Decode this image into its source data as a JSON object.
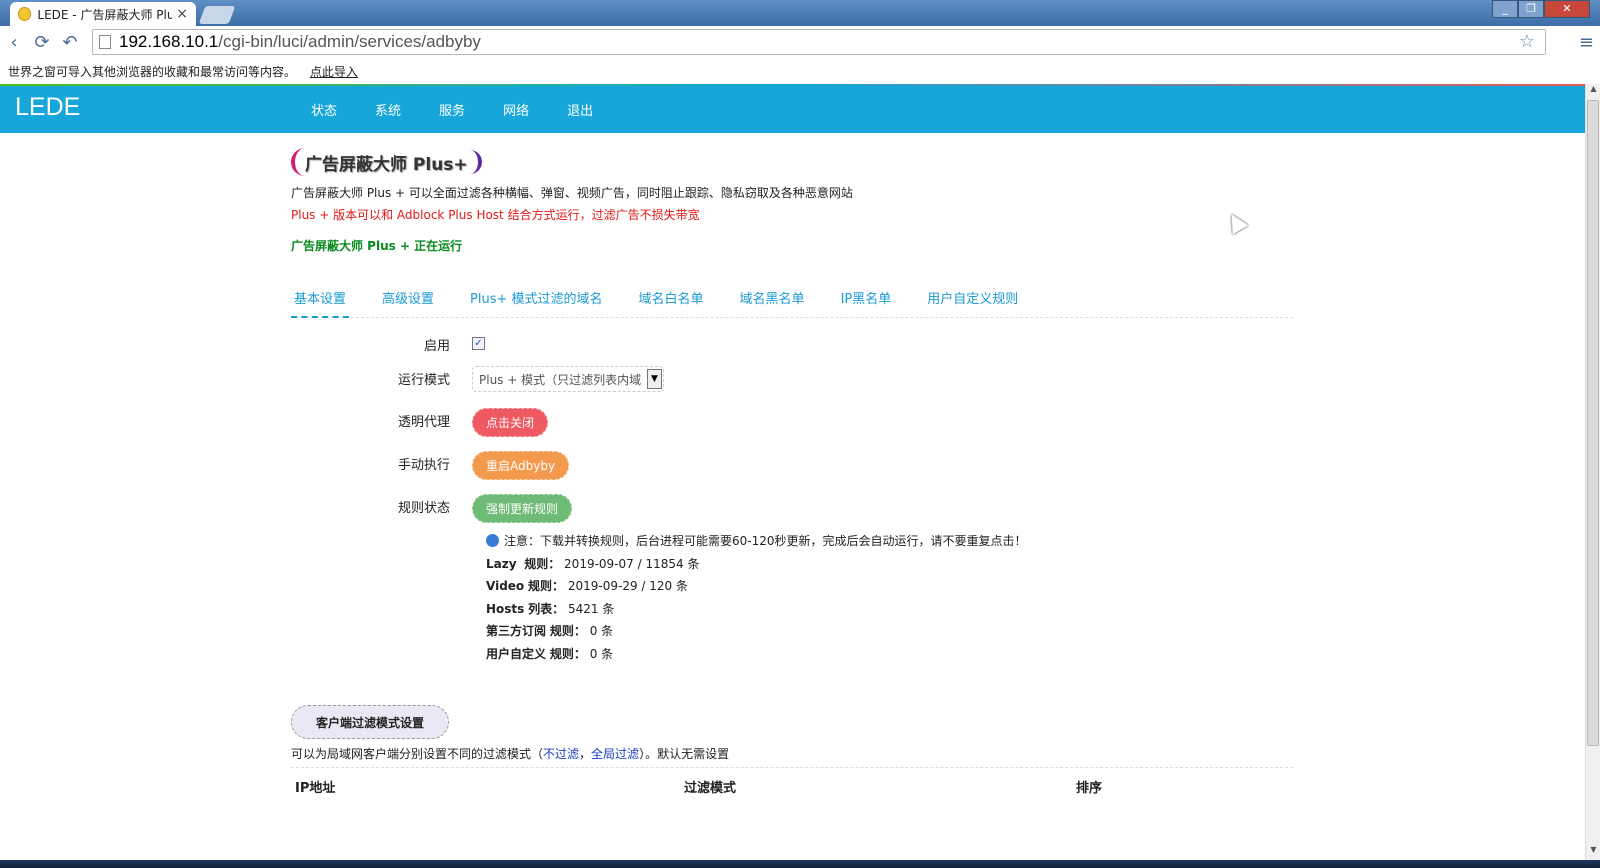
{
  "browser": {
    "tab_title": "LEDE - 广告屏蔽大师 Plus",
    "tab_close": "×",
    "url_host": "192.168.10.1",
    "url_path": "/cgi-bin/luci/admin/services/adbyby",
    "bookmark_message": "世界之窗可导入其他浏览器的收藏和最常访问等内容。",
    "bookmark_link": "点此导入"
  },
  "header": {
    "brand": "LEDE",
    "menu": [
      "状态",
      "系统",
      "服务",
      "网络",
      "退出"
    ]
  },
  "page": {
    "logo_text": "广告屏蔽大师 Plus+",
    "description": "广告屏蔽大师 Plus + 可以全面过滤各种横幅、弹窗、视频广告，同时阻止跟踪、隐私窃取及各种恶意网站",
    "description_red": "Plus + 版本可以和 Adblock Plus Host 结合方式运行，过滤广告不损失带宽",
    "status": "广告屏蔽大师 Plus + 正在运行",
    "tabs": [
      "基本设置",
      "高级设置",
      "Plus+ 模式过滤的域名",
      "域名白名单",
      "域名黑名单",
      "IP黑名单",
      "用户自定义规则"
    ],
    "active_tab": 0
  },
  "form": {
    "enable_label": "启用",
    "enable_checked": true,
    "mode_label": "运行模式",
    "mode_value": "Plus + 模式（只过滤列表内域",
    "proxy_label": "透明代理",
    "proxy_button": "点击关闭",
    "manual_label": "手动执行",
    "manual_button": "重启Adbyby",
    "rules_label": "规则状态",
    "rules_button": "强制更新规则",
    "notice": "注意：下载并转换规则，后台进程可能需要60-120秒更新，完成后会自动运行，请不要重复点击！",
    "rules": [
      {
        "name": "Lazy",
        "label": "规则：",
        "value": "2019-09-07 / 11854 条"
      },
      {
        "name": "Video",
        "label": "规则：",
        "value": "2019-09-29 / 120 条"
      },
      {
        "name": "Hosts",
        "label": "列表：",
        "value": "5421 条"
      },
      {
        "name": "第三方订阅",
        "label": "规则：",
        "value": "0 条"
      },
      {
        "name": "用户自定义",
        "label": "规则：",
        "value": "0 条"
      }
    ]
  },
  "client_section": {
    "title": "客户端过滤模式设置",
    "desc_prefix": "可以为局域网客户端分别设置不同的过滤模式（",
    "link1": "不过滤",
    "sep": "，",
    "link2": "全局过滤",
    "desc_suffix": "）。默认无需设置",
    "columns": [
      "IP地址",
      "过滤模式",
      "排序"
    ]
  }
}
